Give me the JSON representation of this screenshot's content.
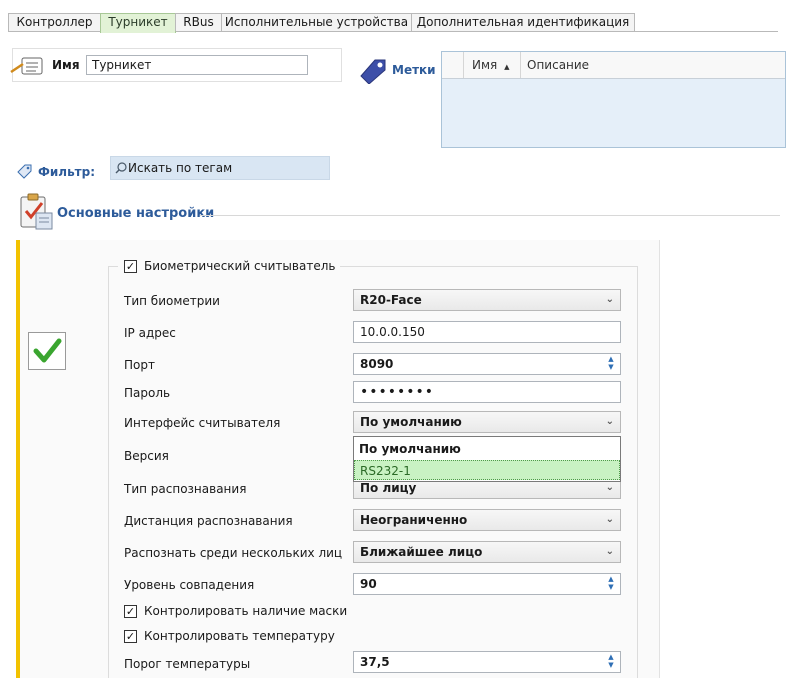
{
  "tabs": [
    {
      "label": "Контроллер",
      "active": false
    },
    {
      "label": "Турникет",
      "active": true
    },
    {
      "label": "RBus",
      "active": false
    },
    {
      "label": "Исполнительные устройства",
      "active": false
    },
    {
      "label": "Дополнительная идентификация",
      "active": false
    }
  ],
  "name": {
    "label": "Имя",
    "value": "Турникет"
  },
  "tags": {
    "label": "Метки",
    "columns": [
      "Имя",
      "Описание"
    ],
    "sort_indicator": "▲"
  },
  "filter": {
    "label": "Фильтр:",
    "search_placeholder": "Искать по тегам"
  },
  "section": {
    "title": "Основные настройки"
  },
  "biometric": {
    "enabled_label": "Биометрический считыватель",
    "enabled": true,
    "fields": {
      "biometry_type": {
        "label": "Тип биометрии",
        "value": "R20-Face"
      },
      "ip": {
        "label": "IP адрес",
        "value": "10.0.0.150"
      },
      "port": {
        "label": "Порт",
        "value": "8090"
      },
      "password": {
        "label": "Пароль",
        "value": "••••••••"
      },
      "interface": {
        "label": "Интерфейс считывателя",
        "value": "По умолчанию"
      },
      "version": {
        "label": "Версия"
      },
      "recognition_type": {
        "label": "Тип распознавания",
        "value": "По лицу"
      },
      "distance": {
        "label": "Дистанция распознавания",
        "value": "Неограниченно"
      },
      "multi_face": {
        "label": "Распознать среди нескольких лиц",
        "value": "Ближайшее лицо"
      },
      "match_level": {
        "label": "Уровень совпадения",
        "value": "90"
      },
      "temp_threshold": {
        "label": "Порог температуры",
        "value": "37,5"
      }
    },
    "mask_check": {
      "label": "Контролировать наличие маски",
      "checked": true
    },
    "temp_check": {
      "label": "Контролировать температуру",
      "checked": true
    },
    "interface_options": [
      "По умолчанию",
      "RS232-1"
    ]
  },
  "icons": {
    "name_icon": "pencil-card-icon",
    "tags_icon": "tag-icon",
    "filter_icon": "tags-icon",
    "search_icon": "search-icon",
    "section_icon": "clipboard-check-icon",
    "status_icon": "checkmark-icon"
  },
  "colors": {
    "accent_blue": "#2d5b9a",
    "active_tab": "#e2f2d6",
    "highlight": "#c9f2c3",
    "yellow_bar": "#f2c200",
    "check_green": "#3aa52f"
  }
}
